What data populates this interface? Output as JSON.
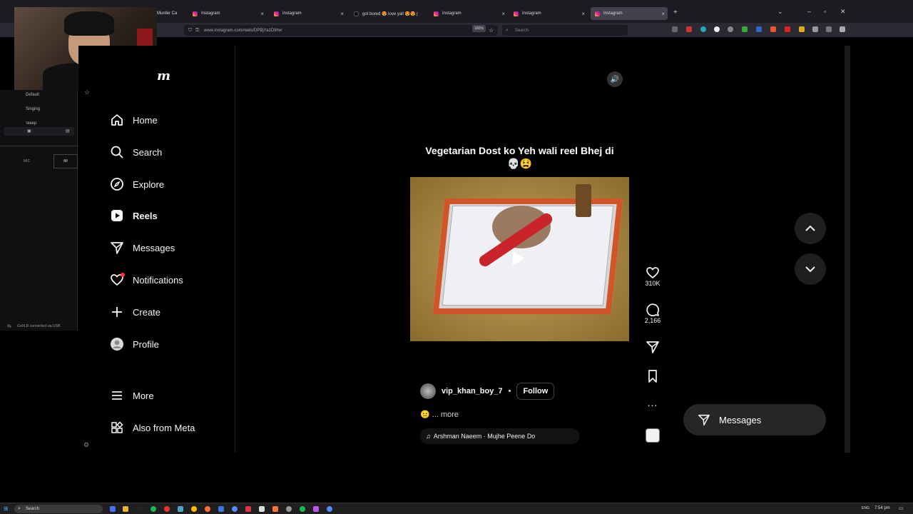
{
  "browser": {
    "tabs": [
      {
        "label": "Murder Ca",
        "active": false
      },
      {
        "label": "Instagram",
        "active": false
      },
      {
        "label": "Instagram",
        "active": false
      },
      {
        "label": "got bored 😍 love yall 😍😍 |",
        "active": false
      },
      {
        "label": "Instagram",
        "active": false
      },
      {
        "label": "Instagram",
        "active": false
      },
      {
        "label": "Instagram",
        "active": true
      }
    ],
    "url": "www.instagram.com/reels/DPBjYa1D8hx/",
    "zoom": "160%",
    "search_placeholder": "Search"
  },
  "obs": {
    "scenes": [
      "Default",
      "Singing",
      "Sleep"
    ],
    "mic_label": "MIC",
    "mic_label2": "MI",
    "status": "GoXLR connected via USB"
  },
  "instagram": {
    "logo": "m",
    "nav": [
      {
        "label": "Home",
        "icon": "home-icon",
        "active": false
      },
      {
        "label": "Search",
        "icon": "search-icon",
        "active": false
      },
      {
        "label": "Explore",
        "icon": "compass-icon",
        "active": false
      },
      {
        "label": "Reels",
        "icon": "reels-icon",
        "active": true
      },
      {
        "label": "Messages",
        "icon": "send-icon",
        "active": false
      },
      {
        "label": "Notifications",
        "icon": "heart-icon",
        "active": false
      },
      {
        "label": "Create",
        "icon": "plus-icon",
        "active": false
      },
      {
        "label": "Profile",
        "icon": "avatar-icon",
        "active": false
      }
    ],
    "more": "More",
    "also_from_meta": "Also from Meta"
  },
  "reel": {
    "caption": "Vegetarian Dost ko Yeh wali reel Bhej di💀😫",
    "username": "vip_khan_boy_7",
    "separator": "•",
    "follow": "Follow",
    "description_emoji": "😐",
    "description_more": "... more",
    "audio": "Arshman Naeem · Mujhe Peene Do",
    "likes": "310K",
    "comments": "2,166",
    "more_options": "..."
  },
  "messages_button": "Messages",
  "taskbar": {
    "search": "Search",
    "lang": "ENG",
    "time": "7:54 pm"
  },
  "colors": {
    "ig_bg": "#000000",
    "accent_red": "#ff3040",
    "follow_border": "#444444"
  }
}
